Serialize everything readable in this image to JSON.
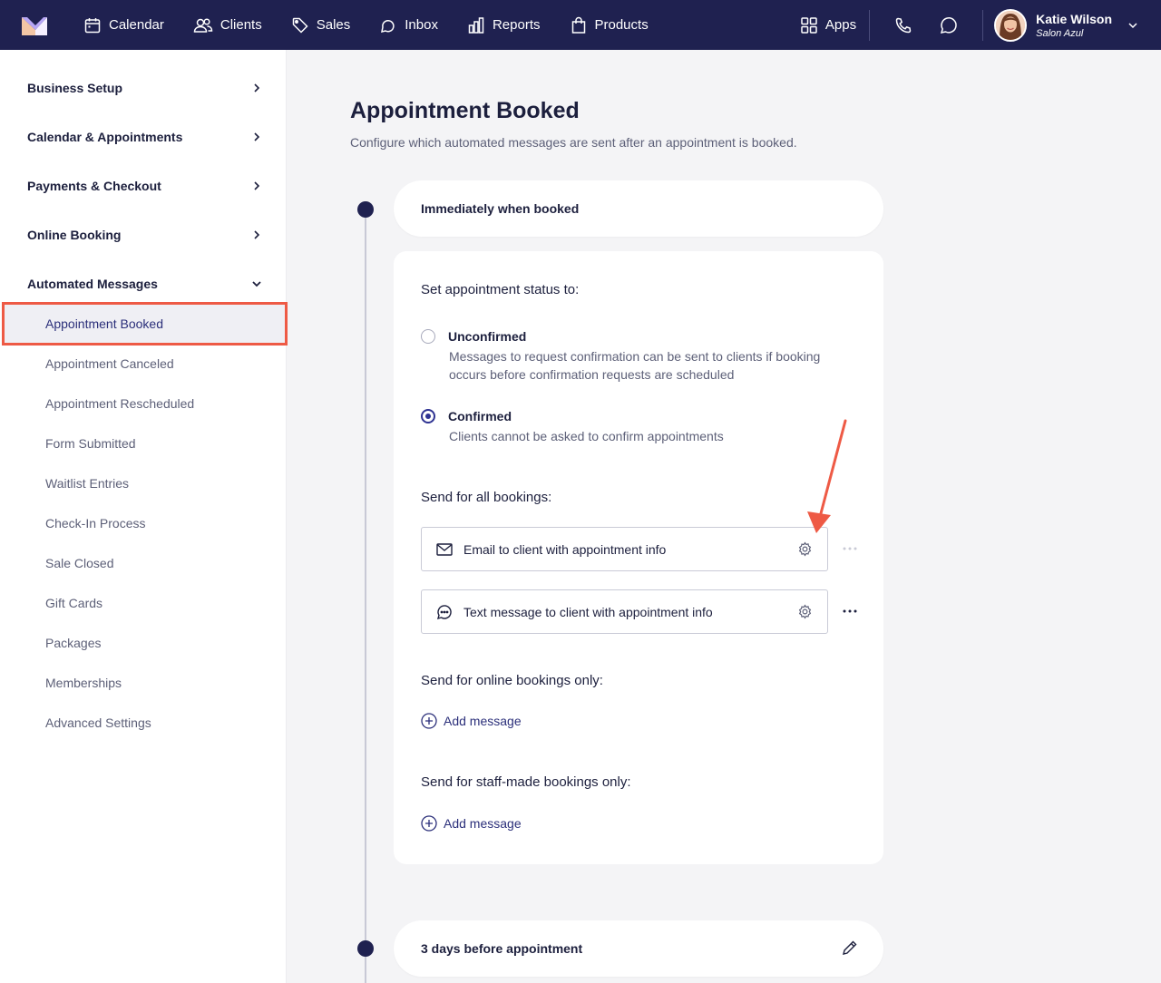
{
  "topbar": {
    "nav": [
      "Calendar",
      "Clients",
      "Sales",
      "Inbox",
      "Reports",
      "Products"
    ],
    "apps_label": "Apps",
    "user_name": "Katie Wilson",
    "user_business": "Salon Azul"
  },
  "sidebar": {
    "sections": [
      "Business Setup",
      "Calendar & Appointments",
      "Payments & Checkout",
      "Online Booking",
      "Automated Messages"
    ],
    "active_item": "Appointment Booked",
    "sub_items": [
      "Appointment Canceled",
      "Appointment Rescheduled",
      "Form Submitted",
      "Waitlist Entries",
      "Check-In Process",
      "Sale Closed",
      "Gift Cards",
      "Packages",
      "Memberships",
      "Advanced Settings"
    ]
  },
  "main": {
    "title": "Appointment Booked",
    "description": "Configure which automated messages are sent after an appointment is booked.",
    "trigger_1": "Immediately when booked",
    "status_heading": "Set appointment status to:",
    "options": [
      {
        "title": "Unconfirmed",
        "desc": "Messages to request confirmation can be sent to clients if booking occurs before confirmation requests are scheduled",
        "selected": false
      },
      {
        "title": "Confirmed",
        "desc": "Clients cannot be asked to confirm appointments",
        "selected": true
      }
    ],
    "all_bookings_heading": "Send for all bookings:",
    "messages": [
      "Email to client with appointment info",
      "Text message to client with appointment info"
    ],
    "online_heading": "Send for online bookings only:",
    "staff_heading": "Send for staff-made bookings only:",
    "add_message": "Add message",
    "trigger_2": "3 days before appointment"
  },
  "colors": {
    "navbar": "#1f2150",
    "accent": "#2f3392",
    "highlight": "#ee5a45"
  }
}
